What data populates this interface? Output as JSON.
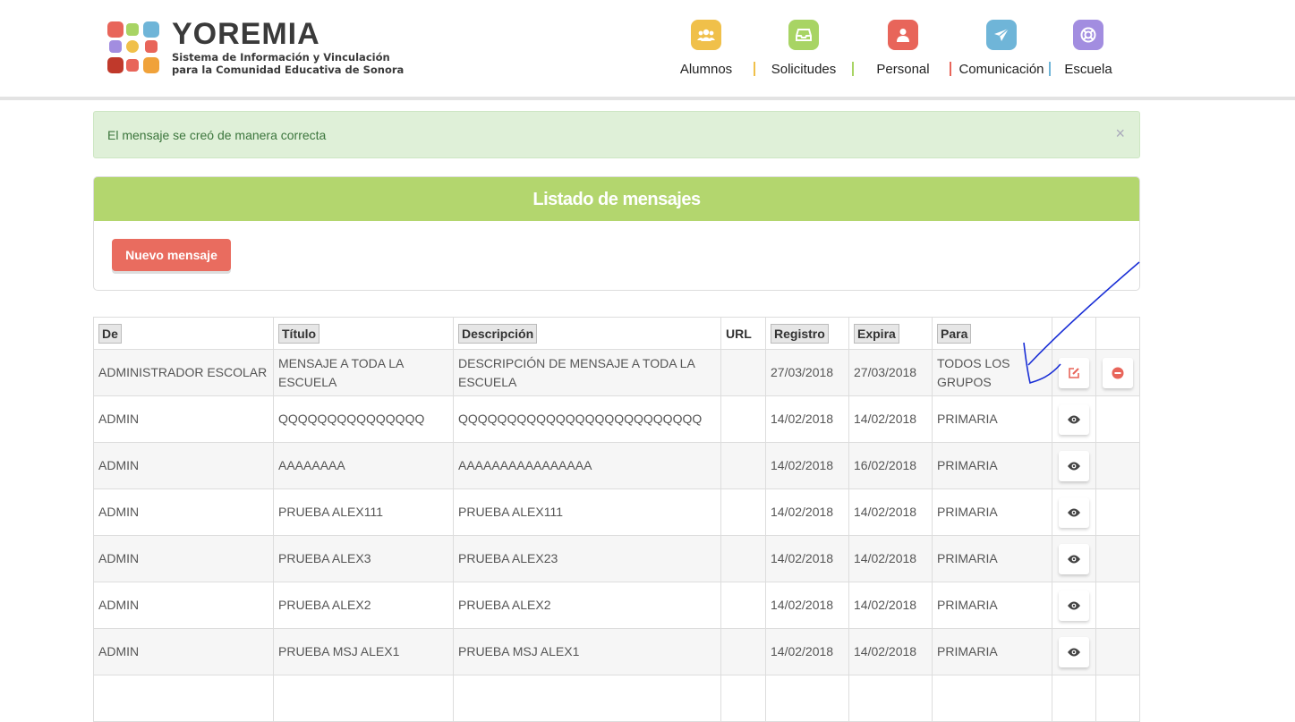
{
  "brand": {
    "name": "YOREMIA",
    "subtitle_line1": "Sistema de Información y Vinculación",
    "subtitle_line2": "para la Comunidad Educativa de Sonora"
  },
  "nav": [
    {
      "label": "Alumnos",
      "icon": "users-icon",
      "color": "#f0c04a"
    },
    {
      "label": "Solicitudes",
      "icon": "inbox-icon",
      "color": "#a8d464"
    },
    {
      "label": "Personal",
      "icon": "user-icon",
      "color": "#e8655a"
    },
    {
      "label": "Comunicación",
      "icon": "paper-plane-icon",
      "color": "#6fb5d8"
    },
    {
      "label": "Escuela",
      "icon": "lifebuoy-icon",
      "color": "#a28de0"
    }
  ],
  "alert": {
    "message": "El mensaje se creó de manera correcta",
    "close": "×"
  },
  "panel": {
    "title": "Listado de mensajes",
    "new_button": "Nuevo mensaje"
  },
  "table": {
    "headers": [
      "De",
      "Título",
      "Descripción",
      "URL",
      "Registro",
      "Expira",
      "Para"
    ],
    "rows": [
      {
        "de": "ADMINISTRADOR ESCOLAR",
        "titulo": "MENSAJE A TODA LA ESCUELA",
        "descripcion": "DESCRIPCIÓN DE MENSAJE A TODA LA ESCUELA",
        "url": "",
        "registro": "27/03/2018",
        "expira": "27/03/2018",
        "para": "TODOS LOS GRUPOS",
        "actions": [
          "edit-icon",
          "delete-icon"
        ]
      },
      {
        "de": "ADMIN",
        "titulo": "QQQQQQQQQQQQQQQ",
        "descripcion": "QQQQQQQQQQQQQQQQQQQQQQQQQ",
        "url": "",
        "registro": "14/02/2018",
        "expira": "14/02/2018",
        "para": "PRIMARIA",
        "actions": [
          "view-icon"
        ]
      },
      {
        "de": "ADMIN",
        "titulo": "AAAAAAAA",
        "descripcion": "AAAAAAAAAAAAAAAA",
        "url": "",
        "registro": "14/02/2018",
        "expira": "16/02/2018",
        "para": "PRIMARIA",
        "actions": [
          "view-icon"
        ]
      },
      {
        "de": "ADMIN",
        "titulo": "PRUEBA ALEX111",
        "descripcion": "PRUEBA ALEX111",
        "url": "",
        "registro": "14/02/2018",
        "expira": "14/02/2018",
        "para": "PRIMARIA",
        "actions": [
          "view-icon"
        ]
      },
      {
        "de": "ADMIN",
        "titulo": "PRUEBA ALEX3",
        "descripcion": "PRUEBA ALEX23",
        "url": "",
        "registro": "14/02/2018",
        "expira": "14/02/2018",
        "para": "PRIMARIA",
        "actions": [
          "view-icon"
        ]
      },
      {
        "de": "ADMIN",
        "titulo": "PRUEBA ALEX2",
        "descripcion": "PRUEBA ALEX2",
        "url": "",
        "registro": "14/02/2018",
        "expira": "14/02/2018",
        "para": "PRIMARIA",
        "actions": [
          "view-icon"
        ]
      },
      {
        "de": "ADMIN",
        "titulo": "PRUEBA MSJ ALEX1",
        "descripcion": "PRUEBA MSJ ALEX1",
        "url": "",
        "registro": "14/02/2018",
        "expira": "14/02/2018",
        "para": "PRIMARIA",
        "actions": [
          "view-icon"
        ]
      }
    ]
  },
  "colors": {
    "edit": "#e8655a",
    "delete": "#e8655a",
    "view": "#444444",
    "annotation": "#1a2fd6"
  }
}
